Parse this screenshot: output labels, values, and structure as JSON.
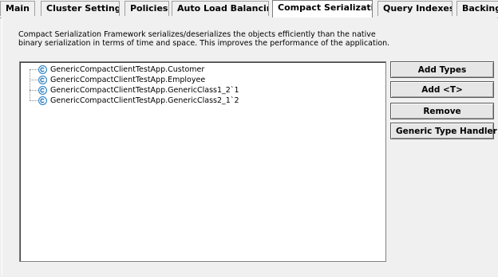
{
  "tabs": [
    {
      "label": "Main",
      "active": false
    },
    {
      "label": "Cluster Settings",
      "active": false
    },
    {
      "label": "Policies",
      "active": false
    },
    {
      "label": "Auto Load Balancing",
      "active": false
    },
    {
      "label": "Compact Serialization",
      "active": true
    },
    {
      "label": "Query Indexes",
      "active": false
    },
    {
      "label": "Backing",
      "active": false
    }
  ],
  "description": {
    "line1": "Compact Serialization Framework serializes/deserializes the objects efficiently than the native",
    "line2": "binary serialization in terms of time and space. This improves the performance of the application."
  },
  "tree": {
    "items": [
      {
        "label": "GenericCompactClientTestApp.Customer",
        "icon": "class-node-icon"
      },
      {
        "label": "GenericCompactClientTestApp.Employee",
        "icon": "class-node-icon"
      },
      {
        "label": "GenericCompactClientTestApp.GenericClass1_2`1",
        "icon": "class-node-icon"
      },
      {
        "label": "GenericCompactClientTestApp.GenericClass2_1`2",
        "icon": "class-node-icon"
      }
    ]
  },
  "buttons": {
    "add_types": "Add Types",
    "add_generic": "Add <T>",
    "remove": "Remove",
    "generic_type_handler": "Generic Type Handler"
  },
  "colors": {
    "background": "#f0f0f0",
    "node_icon": "#2a7fbf"
  }
}
